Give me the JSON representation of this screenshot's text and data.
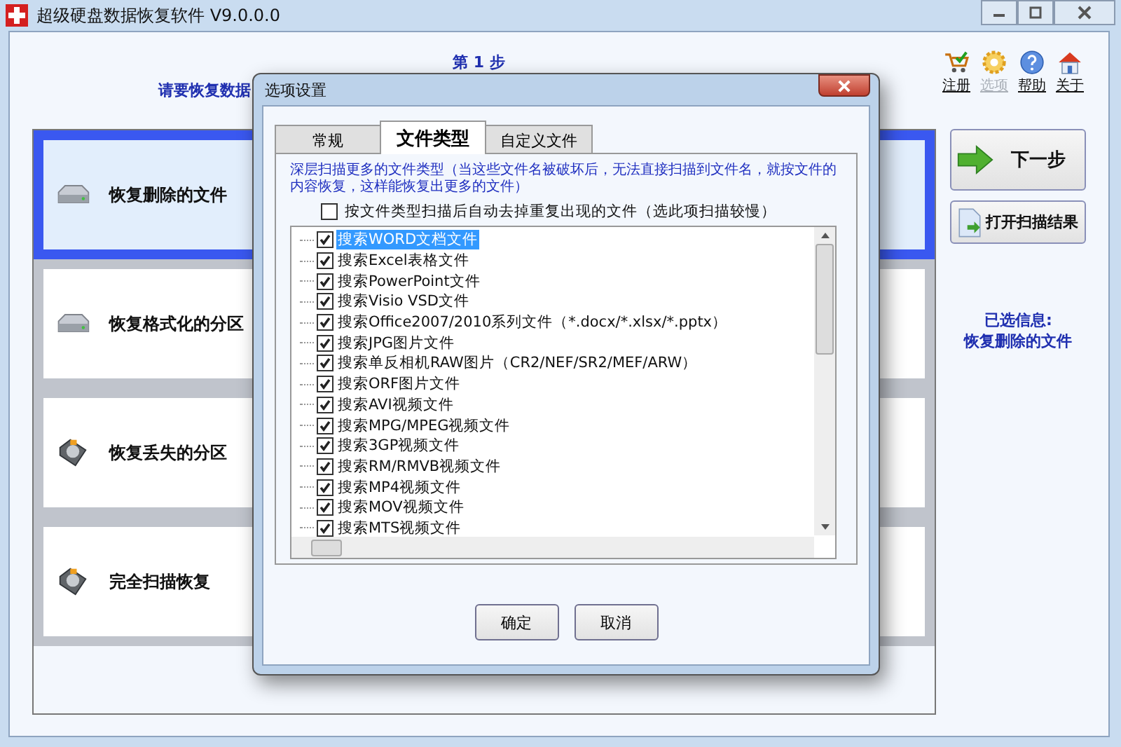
{
  "window": {
    "title": "超级硬盘数据恢复软件 V9.0.0.0"
  },
  "header": {
    "step": "第 1 步",
    "prompt": "请要恢复数据"
  },
  "toolbar": [
    {
      "label": "注册",
      "kind": "cart",
      "disabled": false
    },
    {
      "label": "选项",
      "kind": "gear",
      "disabled": true
    },
    {
      "label": "帮助",
      "kind": "help",
      "disabled": false
    },
    {
      "label": "关于",
      "kind": "home",
      "disabled": false
    }
  ],
  "modes": [
    {
      "label": "恢复删除的文件",
      "kind": "drive",
      "selected": true
    },
    {
      "label": "恢复格式化的分区",
      "kind": "drive",
      "selected": false
    },
    {
      "label": "恢复丢失的分区",
      "kind": "hdd",
      "selected": false
    },
    {
      "label": "完全扫描恢复",
      "kind": "hdd",
      "selected": false
    }
  ],
  "actions": [
    {
      "label": "下一步",
      "kind": "next"
    },
    {
      "label": "打开扫描结果",
      "kind": "open"
    }
  ],
  "selected_info": {
    "title": "已选信息:",
    "value": "恢复删除的文件"
  },
  "dialog": {
    "title": "选项设置",
    "tabs": [
      {
        "label": "常规",
        "selected": false
      },
      {
        "label": "文件类型",
        "selected": true
      },
      {
        "label": "自定义文件",
        "selected": false
      }
    ],
    "description": "深层扫描更多的文件类型（当这些文件名被破坏后，无法直接扫描到文件名，就按文件的内容恢复，这样能恢复出更多的文件）",
    "dedupe_option": {
      "label": "按文件类型扫描后自动去掉重复出现的文件（选此项扫描较慢）",
      "checked": false
    },
    "file_types": [
      {
        "label": "搜索WORD文档文件",
        "checked": true,
        "selected": true
      },
      {
        "label": "搜索Excel表格文件",
        "checked": true,
        "selected": false
      },
      {
        "label": "搜索PowerPoint文件",
        "checked": true,
        "selected": false
      },
      {
        "label": "搜索Visio VSD文件",
        "checked": true,
        "selected": false
      },
      {
        "label": "搜索Office2007/2010系列文件（*.docx/*.xlsx/*.pptx）",
        "checked": true,
        "selected": false
      },
      {
        "label": "搜索JPG图片文件",
        "checked": true,
        "selected": false
      },
      {
        "label": "搜索单反相机RAW图片（CR2/NEF/SR2/MEF/ARW）",
        "checked": true,
        "selected": false
      },
      {
        "label": "搜索ORF图片文件",
        "checked": true,
        "selected": false
      },
      {
        "label": "搜索AVI视频文件",
        "checked": true,
        "selected": false
      },
      {
        "label": "搜索MPG/MPEG视频文件",
        "checked": true,
        "selected": false
      },
      {
        "label": "搜索3GP视频文件",
        "checked": true,
        "selected": false
      },
      {
        "label": "搜索RM/RMVB视频文件",
        "checked": true,
        "selected": false
      },
      {
        "label": "搜索MP4视频文件",
        "checked": true,
        "selected": false
      },
      {
        "label": "搜索MOV视频文件",
        "checked": true,
        "selected": false
      },
      {
        "label": "搜索MTS视频文件",
        "checked": true,
        "selected": false
      }
    ],
    "buttons": [
      "确定",
      "取消"
    ]
  }
}
